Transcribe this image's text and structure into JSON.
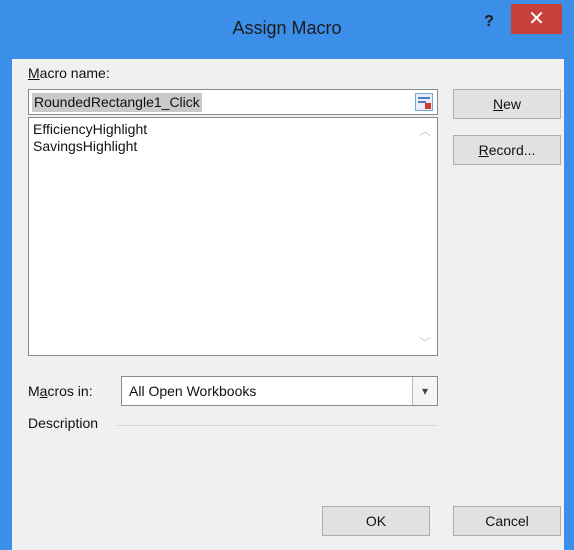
{
  "window": {
    "title": "Assign Macro",
    "help_glyph": "?",
    "close_glyph": "✕"
  },
  "form": {
    "macro_name_label_accel": "M",
    "macro_name_label_rest": "acro name:",
    "macro_name_value": "RoundedRectangle1_Click",
    "macro_list": [
      "EfficiencyHighlight",
      "SavingsHighlight"
    ],
    "macros_in_label_pre": "M",
    "macros_in_label_accel": "a",
    "macros_in_label_rest": "cros in:",
    "macros_in_value": "All Open Workbooks",
    "description_label": "Description"
  },
  "buttons": {
    "new_accel": "N",
    "new_rest": "ew",
    "record_accel": "R",
    "record_rest": "ecord...",
    "ok": "OK",
    "cancel": "Cancel"
  },
  "colors": {
    "titlebar": "#3c8fe8",
    "close": "#c7403a",
    "client": "#f0f0f0"
  }
}
